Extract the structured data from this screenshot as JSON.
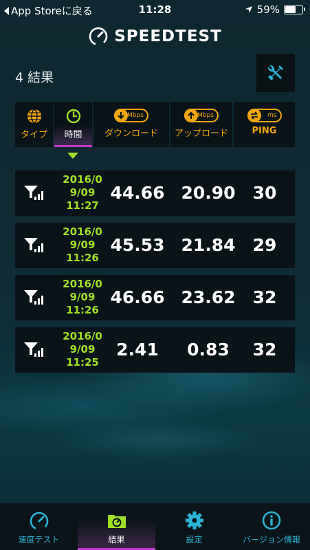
{
  "status_bar": {
    "back_label": "App Storeに戻る",
    "time": "11:28",
    "battery": "59%"
  },
  "header": {
    "brand": "SPEEDTEST",
    "results_count": "4 結果"
  },
  "columns": [
    {
      "label": "タイプ",
      "icon": "globe-icon"
    },
    {
      "label": "時間",
      "icon": "clock-icon"
    },
    {
      "label": "ダウンロード",
      "icon": "download-icon",
      "unit": "Mbps"
    },
    {
      "label": "アップロード",
      "icon": "upload-icon",
      "unit": "Mbps"
    },
    {
      "label": "PING",
      "icon": "ping-icon",
      "unit": "ms"
    }
  ],
  "results": [
    {
      "date_line1": "2016/0",
      "date_line2": "9/09",
      "time": "11:27",
      "download": "44.66",
      "upload": "20.90",
      "ping": "30"
    },
    {
      "date_line1": "2016/0",
      "date_line2": "9/09",
      "time": "11:26",
      "download": "45.53",
      "upload": "21.84",
      "ping": "29"
    },
    {
      "date_line1": "2016/0",
      "date_line2": "9/09",
      "time": "11:26",
      "download": "46.66",
      "upload": "23.62",
      "ping": "32"
    },
    {
      "date_line1": "2016/0",
      "date_line2": "9/09",
      "time": "11:25",
      "download": "2.41",
      "upload": "0.83",
      "ping": "32"
    }
  ],
  "tabs": [
    {
      "label": "速度テスト",
      "icon": "speedometer-icon"
    },
    {
      "label": "結果",
      "icon": "results-folder-icon"
    },
    {
      "label": "設定",
      "icon": "gear-icon"
    },
    {
      "label": "バージョン情報",
      "icon": "info-icon"
    }
  ],
  "colors": {
    "accent_orange": "#f2a50d",
    "accent_green": "#9fe025",
    "accent_blue": "#2ab3d6",
    "accent_purple": "#c23ad0"
  }
}
